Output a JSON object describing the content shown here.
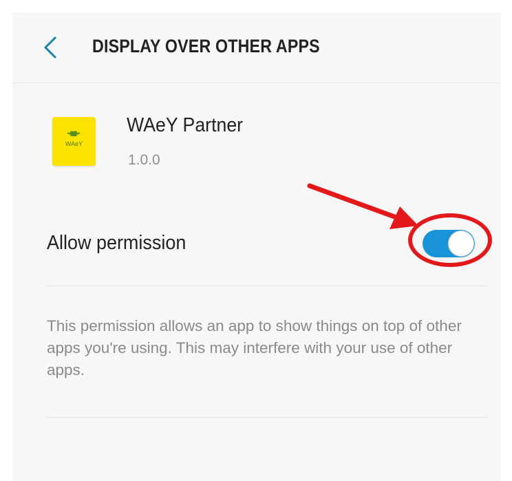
{
  "header": {
    "title": "DISPLAY OVER OTHER APPS",
    "back_icon": "chevron-left-icon"
  },
  "app": {
    "name": "WAeY Partner",
    "version": "1.0.0",
    "icon_text": "WAeY",
    "icon_color": "#fde400"
  },
  "permission": {
    "label": "Allow permission",
    "enabled": true,
    "toggle_color": "#1a94d8"
  },
  "description": "This permission allows an app to show things on top of other apps you're using. This may interfere with your use of other apps.",
  "annotation": {
    "color": "#e3181b"
  }
}
